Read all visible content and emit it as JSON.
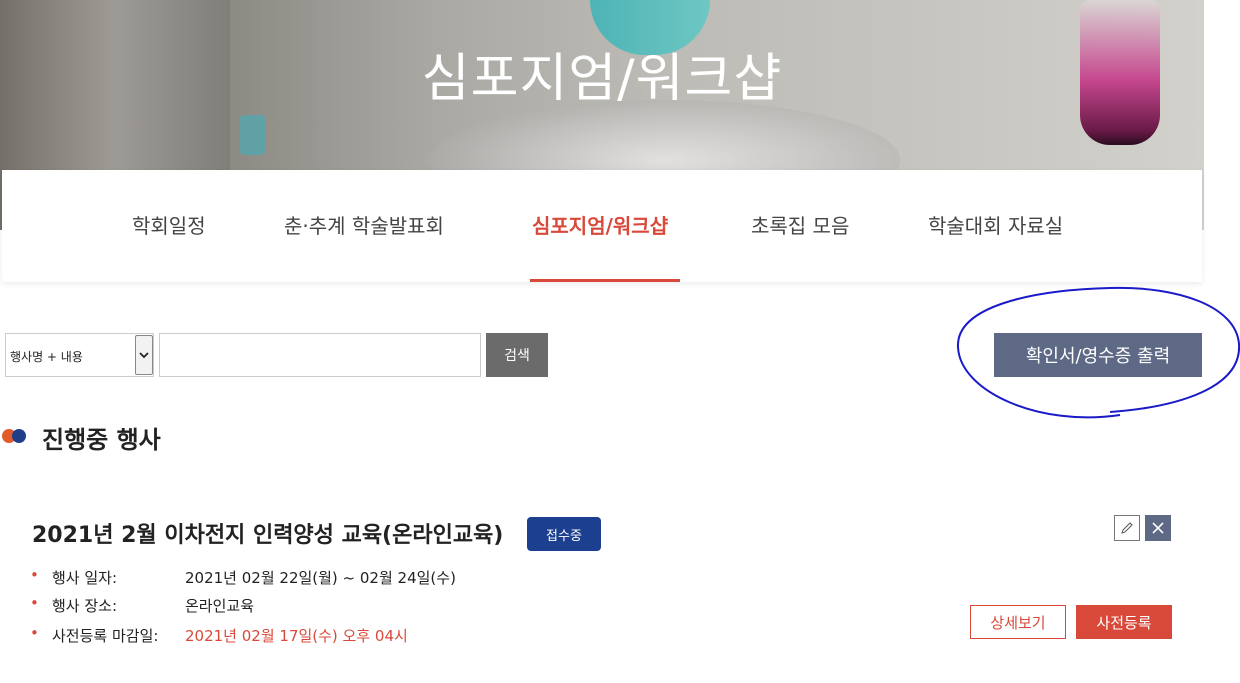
{
  "hero": {
    "title": "심포지엄/워크샵"
  },
  "tabs": [
    {
      "label": "학회일정"
    },
    {
      "label": "춘·추계 학술발표회"
    },
    {
      "label": "심포지엄/워크샵"
    },
    {
      "label": "초록집 모음"
    },
    {
      "label": "학술대회 자료실"
    }
  ],
  "active_tab": "심포지엄/워크샵",
  "search": {
    "select_value": "행사명 + 내용",
    "input_value": "",
    "button_label": "검색"
  },
  "print_button_label": "확인서/영수증 출력",
  "section": {
    "title": "진행중 행사"
  },
  "event": {
    "title": "2021년 2월 이차전지 인력양성 교육(온라인교육)",
    "status": "접수중",
    "rows": [
      {
        "label": "행사 일자:",
        "value": "2021년 02월 22일(월) ~ 02월 24일(수)"
      },
      {
        "label": "행사 장소:",
        "value": "온라인교육"
      },
      {
        "label": "사전등록 마감일:",
        "value": "2021년 02월 17일(수) 오후 04시"
      }
    ],
    "detail_label": "상세보기",
    "preregister_label": "사전등록"
  },
  "colors": {
    "accent": "#d9493a",
    "navy": "#1c3f8f",
    "slate": "#5d6985",
    "annotation": "#1a1ac8"
  },
  "icons": {
    "edit": "pencil-icon",
    "close": "close-icon",
    "select_arrow": "chevron-down-icon"
  }
}
